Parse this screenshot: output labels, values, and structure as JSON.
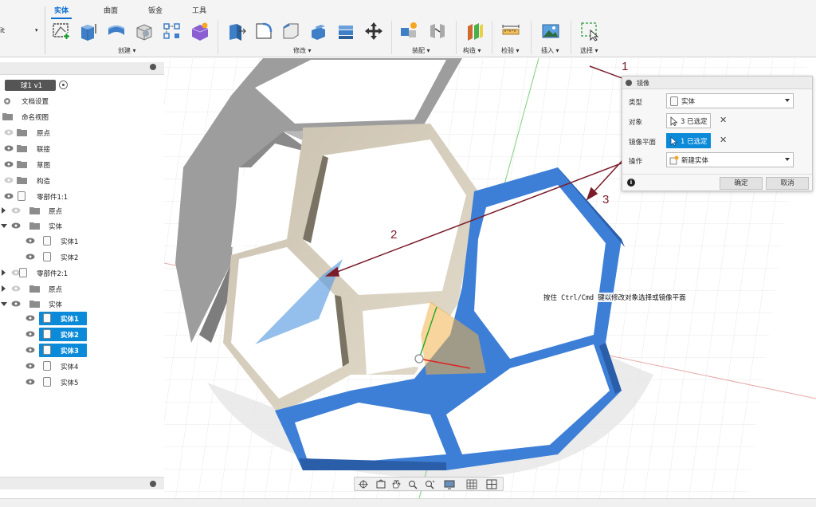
{
  "toolbar": {
    "workspace_label": "it",
    "tabs": [
      "实体",
      "曲面",
      "钣金",
      "工具"
    ],
    "active_tab": "实体",
    "groups": [
      "创建 ▾",
      "修改 ▾",
      "装配 ▾",
      "构造 ▾",
      "检验 ▾",
      "插入 ▾",
      "选择 ▾"
    ]
  },
  "browser": {
    "header_label": "",
    "root": "球1 v1",
    "items": [
      "文档设置",
      "命名视图",
      "原点",
      "联接",
      "草图",
      "构造",
      "零部件1:1",
      "原点",
      "实体",
      "实体1",
      "实体2",
      "零部件2:1",
      "原点",
      "实体",
      "实体1",
      "实体2",
      "实体3",
      "实体4",
      "实体5"
    ]
  },
  "dialog": {
    "title": "镜像",
    "type_label": "类型",
    "type_value": "实体",
    "objects_label": "对象",
    "objects_value": "3 已选定",
    "plane_label": "镜像平面",
    "plane_value": "1 已选定",
    "operation_label": "操作",
    "operation_value": "新建实体",
    "ok_label": "确定",
    "cancel_label": "取消"
  },
  "tooltip": "按住 Ctrl/Cmd 键以修改对象选择或镜像平面",
  "annotations": [
    "1",
    "2",
    "3"
  ],
  "colors": {
    "accent_blue": "#0a8ad8",
    "selected_body": "#3d7fd6",
    "body_gray": "#9a9a9a",
    "body_beige": "#cfc6b4",
    "plane_orange": "#f2b24a",
    "arrow_maroon": "#7a1c2a"
  }
}
